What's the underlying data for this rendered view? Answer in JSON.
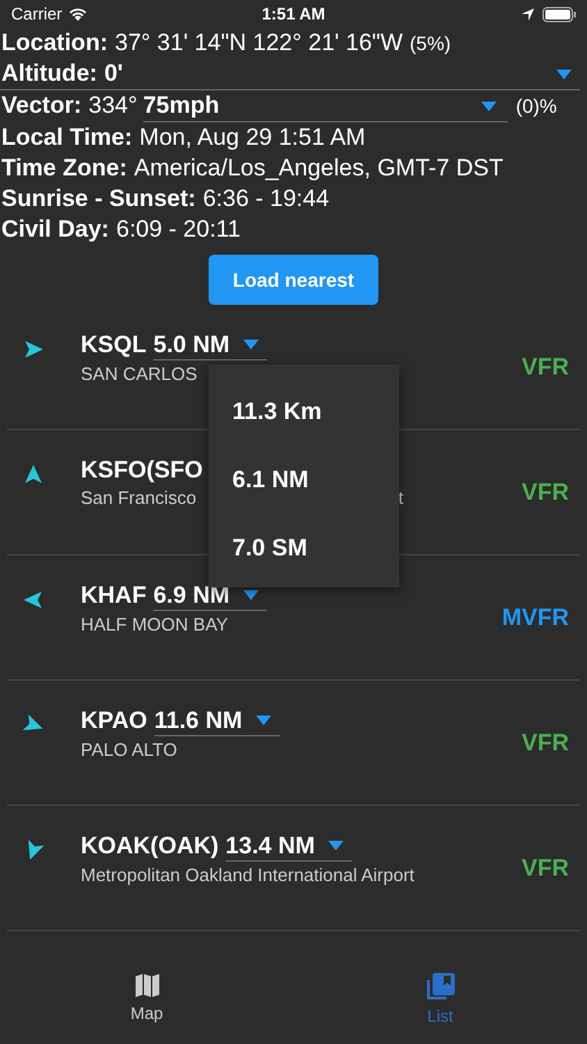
{
  "status_bar": {
    "carrier": "Carrier",
    "time": "1:51 AM"
  },
  "info": {
    "location": {
      "label": "Location:",
      "value": "37° 31' 14\"N 122° 21' 16\"W",
      "accuracy": "(5%)"
    },
    "altitude": {
      "label": "Altitude:",
      "value": "0'"
    },
    "vector": {
      "label": "Vector:",
      "heading": "334°",
      "speed": "75mph",
      "suffix": "(0)%"
    },
    "lines": [
      {
        "label": "Local Time:",
        "value": "Mon, Aug 29 1:51 AM"
      },
      {
        "label": "Time Zone:",
        "value": "America/Los_Angeles, GMT-7 DST"
      },
      {
        "label": "Sunrise - Sunset:",
        "value": "6:36 - 19:44"
      },
      {
        "label": "Civil Day:",
        "value": "6:09 - 20:11"
      }
    ]
  },
  "load_button": "Load nearest",
  "airports": [
    {
      "code": "KSQL",
      "distance": "5.0 NM",
      "name": "SAN CARLOS",
      "category": "VFR",
      "color": "#4caf50"
    },
    {
      "code": "KSFO(SFO",
      "name": "San Francisco",
      "name_tail": "t",
      "category": "VFR",
      "color": "#4caf50"
    },
    {
      "code": "KHAF",
      "distance": "6.9 NM",
      "name": "HALF MOON BAY",
      "category": "MVFR",
      "color": "#2196f3"
    },
    {
      "code": "KPAO",
      "distance": "11.6 NM",
      "name": "PALO ALTO",
      "category": "VFR",
      "color": "#4caf50"
    },
    {
      "code": "KOAK(OAK)",
      "distance": "13.4 NM",
      "name": "Metropolitan Oakland International Airport",
      "category": "VFR",
      "color": "#4caf50"
    }
  ],
  "distance_menu": [
    "11.3 Km",
    "6.1 NM",
    "7.0 SM"
  ],
  "tabs": [
    {
      "label": "Map",
      "kind": "map",
      "selected": false
    },
    {
      "label": "List",
      "kind": "list",
      "selected": true
    }
  ]
}
